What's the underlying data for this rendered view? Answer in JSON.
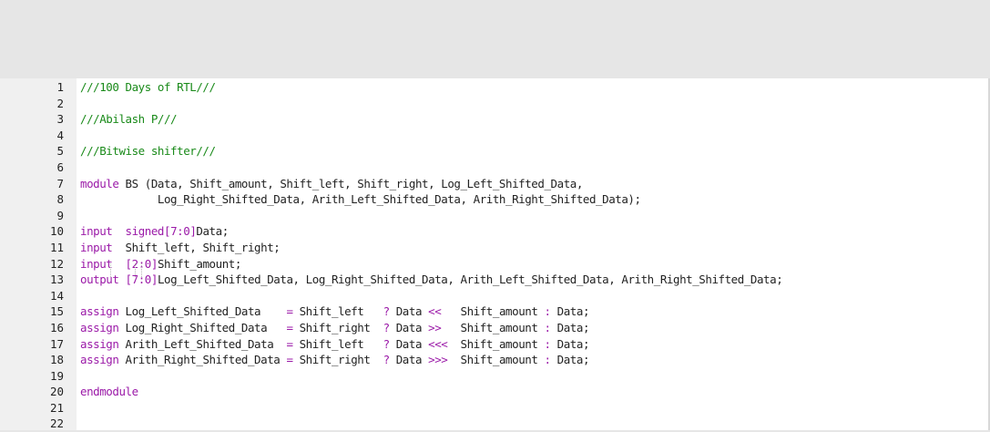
{
  "editor": {
    "lines": [
      {
        "num": "1",
        "tokens": [
          {
            "t": "///100 Days of RTL///",
            "c": "comment"
          }
        ]
      },
      {
        "num": "2",
        "tokens": []
      },
      {
        "num": "3",
        "tokens": [
          {
            "t": "///Abilash P///",
            "c": "comment"
          }
        ]
      },
      {
        "num": "4",
        "tokens": []
      },
      {
        "num": "5",
        "tokens": [
          {
            "t": "///Bitwise shifter///",
            "c": "comment"
          }
        ]
      },
      {
        "num": "6",
        "tokens": []
      },
      {
        "num": "7",
        "tokens": [
          {
            "t": "module",
            "c": "kw"
          },
          {
            "t": " BS (Data, Shift_amount, Shift_left, Shift_right, Log_Left_Shifted_Data,",
            "c": "plain"
          }
        ]
      },
      {
        "num": "8",
        "tokens": [
          {
            "t": "            Log_Right_Shifted_Data, Arith_Left_Shifted_Data, Arith_Right_Shifted_Data);",
            "c": "plain"
          }
        ]
      },
      {
        "num": "9",
        "tokens": []
      },
      {
        "num": "10",
        "tokens": [
          {
            "t": "input",
            "c": "kw"
          },
          {
            "t": "  ",
            "c": "plain"
          },
          {
            "t": "signed",
            "c": "kw"
          },
          {
            "t": "[7:0]",
            "c": "kw"
          },
          {
            "t": "Data;",
            "c": "plain"
          }
        ]
      },
      {
        "num": "11",
        "tokens": [
          {
            "t": "input",
            "c": "kw"
          },
          {
            "t": "  Shift_left, Shift_right;",
            "c": "plain"
          }
        ]
      },
      {
        "num": "12",
        "tokens": [
          {
            "t": "input",
            "c": "kw"
          },
          {
            "t": "  ",
            "c": "plain"
          },
          {
            "t": "[2:0]",
            "c": "kw"
          },
          {
            "t": "Shift_amount;",
            "c": "plain"
          }
        ]
      },
      {
        "num": "13",
        "tokens": [
          {
            "t": "output",
            "c": "kw"
          },
          {
            "t": " ",
            "c": "plain"
          },
          {
            "t": "[7:0]",
            "c": "kw"
          },
          {
            "t": "Log_Left_Shifted_Data, Log_Right_Shifted_Data, Arith_Left_Shifted_Data, Arith_Right_Shifted_Data;",
            "c": "plain"
          }
        ]
      },
      {
        "num": "14",
        "tokens": []
      },
      {
        "num": "15",
        "tokens": [
          {
            "t": "assign",
            "c": "kw"
          },
          {
            "t": " Log_Left_Shifted_Data    ",
            "c": "plain"
          },
          {
            "t": "=",
            "c": "op"
          },
          {
            "t": " Shift_left   ",
            "c": "plain"
          },
          {
            "t": "?",
            "c": "op"
          },
          {
            "t": " Data ",
            "c": "plain"
          },
          {
            "t": "<<",
            "c": "op"
          },
          {
            "t": "   Shift_amount ",
            "c": "plain"
          },
          {
            "t": ":",
            "c": "op"
          },
          {
            "t": " Data;",
            "c": "plain"
          }
        ]
      },
      {
        "num": "16",
        "tokens": [
          {
            "t": "assign",
            "c": "kw"
          },
          {
            "t": " Log_Right_Shifted_Data   ",
            "c": "plain"
          },
          {
            "t": "=",
            "c": "op"
          },
          {
            "t": " Shift_right  ",
            "c": "plain"
          },
          {
            "t": "?",
            "c": "op"
          },
          {
            "t": " Data ",
            "c": "plain"
          },
          {
            "t": ">>",
            "c": "op"
          },
          {
            "t": "   Shift_amount ",
            "c": "plain"
          },
          {
            "t": ":",
            "c": "op"
          },
          {
            "t": " Data;",
            "c": "plain"
          }
        ]
      },
      {
        "num": "17",
        "tokens": [
          {
            "t": "assign",
            "c": "kw"
          },
          {
            "t": " Arith_Left_Shifted_Data  ",
            "c": "plain"
          },
          {
            "t": "=",
            "c": "op"
          },
          {
            "t": " Shift_left   ",
            "c": "plain"
          },
          {
            "t": "?",
            "c": "op"
          },
          {
            "t": " Data ",
            "c": "plain"
          },
          {
            "t": "<<<",
            "c": "op"
          },
          {
            "t": "  Shift_amount ",
            "c": "plain"
          },
          {
            "t": ":",
            "c": "op"
          },
          {
            "t": " Data;",
            "c": "plain"
          }
        ]
      },
      {
        "num": "18",
        "tokens": [
          {
            "t": "assign",
            "c": "kw"
          },
          {
            "t": " Arith_Right_Shifted_Data ",
            "c": "plain"
          },
          {
            "t": "=",
            "c": "op"
          },
          {
            "t": " Shift_right  ",
            "c": "plain"
          },
          {
            "t": "?",
            "c": "op"
          },
          {
            "t": " Data ",
            "c": "plain"
          },
          {
            "t": ">>>",
            "c": "op"
          },
          {
            "t": "  Shift_amount ",
            "c": "plain"
          },
          {
            "t": ":",
            "c": "op"
          },
          {
            "t": " Data;",
            "c": "plain"
          }
        ]
      },
      {
        "num": "19",
        "tokens": []
      },
      {
        "num": "20",
        "tokens": [
          {
            "t": "endmodule",
            "c": "kw"
          }
        ]
      },
      {
        "num": "21",
        "tokens": []
      },
      {
        "num": "22",
        "tokens": []
      }
    ]
  },
  "colors": {
    "comment": "#198a19",
    "keyword": "#9b1aa8",
    "text": "#222222",
    "gutter_bg": "#f0f0f0",
    "chrome_bg": "#e6e6e6"
  }
}
